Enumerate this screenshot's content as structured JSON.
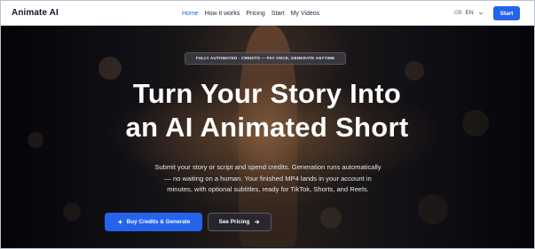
{
  "header": {
    "brand": "Animate AI",
    "nav": [
      "Home",
      "How it works",
      "Pricing",
      "Start",
      "My Videos"
    ],
    "active_nav": "Home",
    "language": {
      "flag": "GB",
      "code": "EN"
    },
    "start_label": "Start"
  },
  "hero": {
    "badge": "FULLY AUTOMATED · CREDITS — PAY ONCE, GENERATE ANYTIME",
    "title_line1": "Turn Your Story Into",
    "title_line2": "an AI Animated Short",
    "subtitle": "Submit your story or script and spend credits. Generation runs automatically — no waiting on a human. Your finished MP4 lands in your account in minutes, with optional subtitles, ready for TikTok, Shorts, and Reels.",
    "primary_cta": "Buy Credits & Generate",
    "secondary_cta": "See Pricing",
    "primary_icon": "sparkle-icon",
    "secondary_icon": "arrow-right-icon"
  },
  "colors": {
    "accent": "#2563eb",
    "header_bg": "#ffffff",
    "hero_text": "#ffffff"
  }
}
